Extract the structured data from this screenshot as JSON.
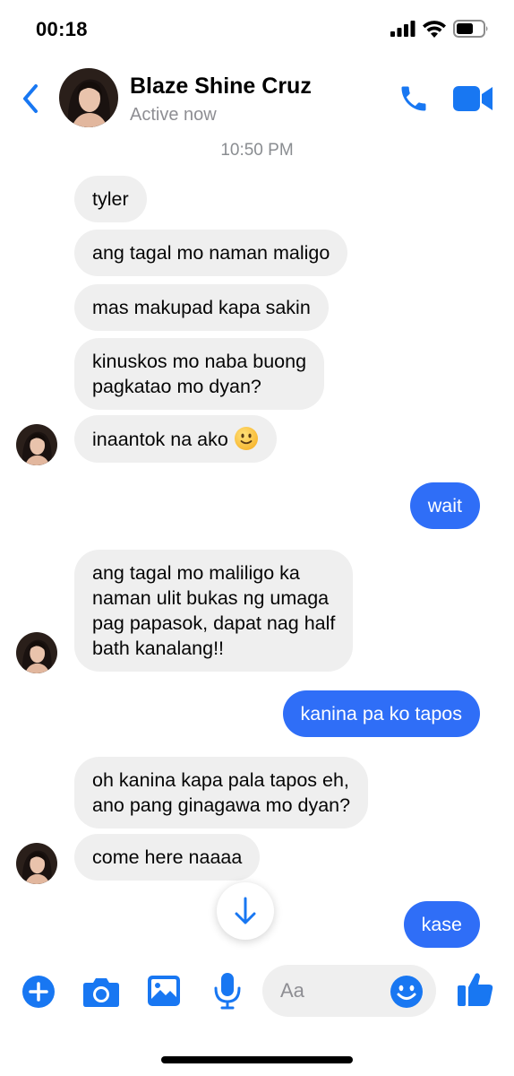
{
  "status_bar": {
    "time": "00:18"
  },
  "header": {
    "contact_name": "Blaze Shine Cruz",
    "contact_status": "Active now"
  },
  "conversation": {
    "timestamp": "10:50 PM",
    "messages": [
      {
        "from": "them",
        "text": "tyler"
      },
      {
        "from": "them",
        "text": "ang tagal mo naman maligo"
      },
      {
        "from": "them",
        "text": "mas makupad kapa sakin"
      },
      {
        "from": "them",
        "lines": [
          "kinuskos mo naba buong",
          "pagkatao mo dyan?"
        ]
      },
      {
        "from": "them",
        "text": "inaantok na ako",
        "emoji": "slightly-smiling-face"
      },
      {
        "from": "me",
        "text": "wait"
      },
      {
        "from": "them",
        "lines": [
          "ang tagal mo maliligo ka",
          "naman ulit bukas ng umaga",
          "pag papasok,  dapat nag half",
          "bath kanalang!!"
        ]
      },
      {
        "from": "me",
        "text": "kanina pa ko tapos"
      },
      {
        "from": "them",
        "lines": [
          "oh kanina kapa pala tapos eh,",
          "ano pang ginagawa mo dyan?"
        ]
      },
      {
        "from": "them",
        "text": "come here naaaa"
      },
      {
        "from": "me",
        "text": "kase"
      }
    ]
  },
  "composer": {
    "placeholder": "Aa",
    "icons": [
      "plus-icon",
      "camera-icon",
      "image-icon",
      "microphone-icon",
      "emoji-icon",
      "thumbs-up-icon"
    ]
  },
  "colors": {
    "accent": "#1877f2",
    "outgoing_bubble": "#2f6ef7",
    "incoming_bubble": "#efefef"
  }
}
